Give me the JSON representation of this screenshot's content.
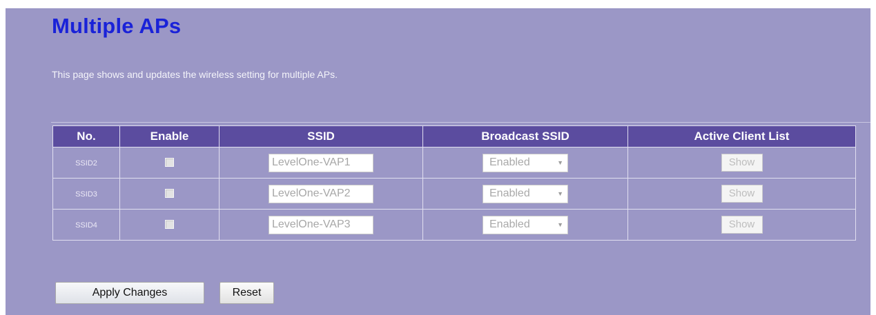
{
  "page": {
    "title": "Multiple APs",
    "description": "This page shows and updates the wireless setting for multiple APs."
  },
  "table": {
    "headers": {
      "no": "No.",
      "enable": "Enable",
      "ssid": "SSID",
      "broadcast": "Broadcast SSID",
      "clients": "Active Client List"
    },
    "rows": [
      {
        "no": "SSID2",
        "enabled": false,
        "ssid": "LevelOne-VAP1",
        "broadcast": "Enabled",
        "action": "Show"
      },
      {
        "no": "SSID3",
        "enabled": false,
        "ssid": "LevelOne-VAP2",
        "broadcast": "Enabled",
        "action": "Show"
      },
      {
        "no": "SSID4",
        "enabled": false,
        "ssid": "LevelOne-VAP3",
        "broadcast": "Enabled",
        "action": "Show"
      }
    ]
  },
  "buttons": {
    "apply": "Apply Changes",
    "reset": "Reset"
  },
  "colors": {
    "background": "#9b97c6",
    "title": "#1a22d8",
    "header": "#5b4c9f"
  }
}
